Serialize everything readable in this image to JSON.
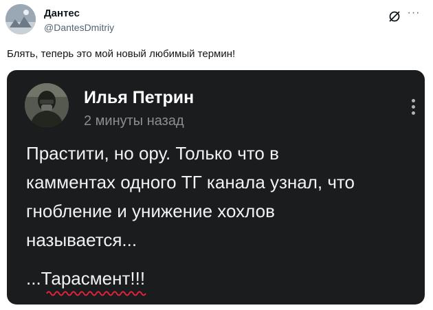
{
  "tweet": {
    "author_name": "Дантес",
    "author_handle": "@DantesDmitriy",
    "text": "Блять, теперь это мой новый любимый термин!",
    "grok_icon": "grok-icon",
    "more_icon": "more-icon"
  },
  "embed": {
    "author_name": "Илья Петрин",
    "timestamp": "2 минуты назад",
    "body_lines": [
      "Прастити, но ору. Только что в",
      "камментах одного ТГ канала узнал, что",
      "гнобление и унижение хохлов",
      "называется..."
    ],
    "punchline": "...Тарасмент!!!",
    "menu_icon": "kebab-menu-icon",
    "colors": {
      "background": "#1b1c1e",
      "text": "#f2f2f2",
      "muted": "#8a8f93",
      "underline": "#e5213b"
    }
  }
}
